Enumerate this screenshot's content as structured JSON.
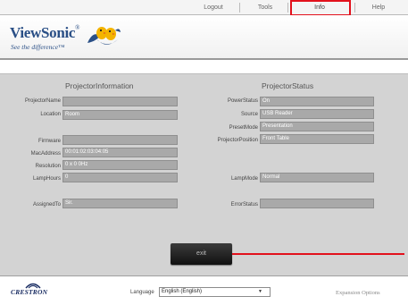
{
  "nav": {
    "items": [
      "Logout",
      "Tools",
      "Info",
      "Help"
    ],
    "active": "Info",
    "highlight_color": "#e2111c"
  },
  "banner": {
    "brand": "ViewSonic",
    "brand_tm": "®",
    "tagline": "See the difference™"
  },
  "info": {
    "title": "ProjectorInformation",
    "fields": [
      {
        "label": "ProjectorName",
        "value": ""
      },
      {
        "label": "Location",
        "value": "Room"
      },
      {
        "label": "Firmware",
        "value": ""
      },
      {
        "label": "MacAddress",
        "value": "00:01:02:03:04:05"
      },
      {
        "label": "Resolution",
        "value": "0 x 0 0Hz"
      },
      {
        "label": "LampHours",
        "value": "0"
      },
      {
        "label": "AssignedTo",
        "value": "Sir."
      }
    ]
  },
  "status": {
    "title": "ProjectorStatus",
    "fields": [
      {
        "label": "PowerStatus",
        "value": "On"
      },
      {
        "label": "Source",
        "value": "USB Reader"
      },
      {
        "label": "PresetMode",
        "value": "Presentation"
      },
      {
        "label": "ProjectorPosition",
        "value": "Front Table"
      },
      {
        "label": "LampMode",
        "value": "Normal"
      },
      {
        "label": "ErrorStatus",
        "value": ""
      }
    ]
  },
  "exit_label": "exit",
  "footer": {
    "crestron": "CRESTRON",
    "language_label": "Language",
    "language_value": "English (English)",
    "expansion": "Expansion Options"
  },
  "colors": {
    "accent_red": "#e2111c",
    "brand_blue": "#2a4f86",
    "panel_gray": "#d3d3d3",
    "field_gray": "#a9a9a9"
  }
}
